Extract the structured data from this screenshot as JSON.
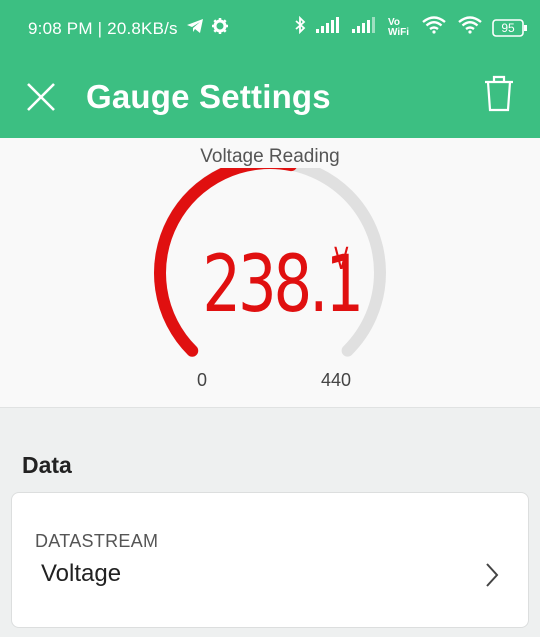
{
  "status_bar": {
    "time_speed": "9:08 PM | 20.8KB/s",
    "battery": "95",
    "volte_label": "Vo WiFi"
  },
  "app_bar": {
    "title": "Gauge Settings"
  },
  "gauge": {
    "title": "Voltage Reading",
    "value": "238.1",
    "unit": "V",
    "min_label": "0",
    "max_label": "440",
    "min": 0,
    "max": 440,
    "current": 238.1,
    "color": "#e01010",
    "track_color": "#e0e0e0"
  },
  "data_section": {
    "heading": "Data",
    "datastream_label": "DATASTREAM",
    "datastream_value": "Voltage"
  },
  "colors": {
    "brand": "#3cbf82"
  }
}
